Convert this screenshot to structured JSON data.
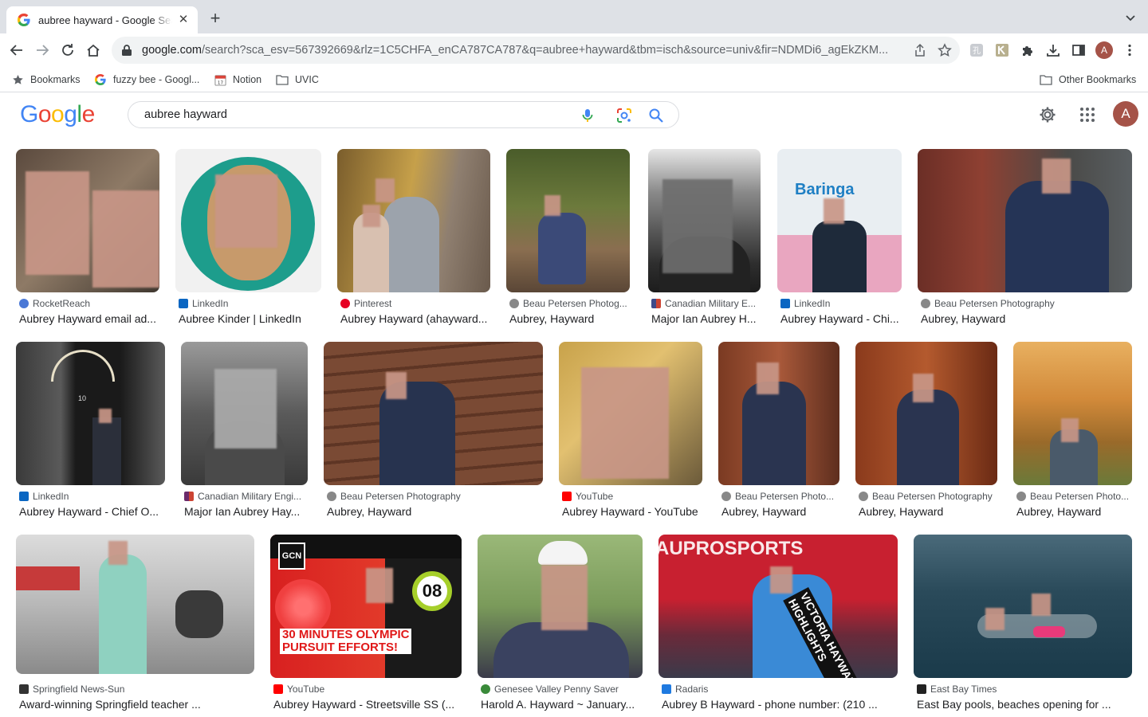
{
  "browser": {
    "tab_title": "aubree hayward - Google Search",
    "url_host": "google.com",
    "url_path": "/search?sca_esv=567392669&rlz=1C5CHFA_enCA787CA787&q=aubree+hayward&tbm=isch&source=univ&fir=NDMDi6_agEkZKM..."
  },
  "bookmarks": {
    "items": [
      "Bookmarks",
      "fuzzy bee - Googl...",
      "Notion",
      "UVIC"
    ],
    "other": "Other Bookmarks"
  },
  "google": {
    "logo": [
      "G",
      "o",
      "o",
      "g",
      "l",
      "e"
    ],
    "query": "aubree hayward",
    "avatar_letter": "A"
  },
  "profile_letter": "A",
  "results": [
    {
      "source": "RocketReach",
      "caption": "Aubrey Hayward email ad..."
    },
    {
      "source": "LinkedIn",
      "caption": "Aubree Kinder | LinkedIn"
    },
    {
      "source": "Pinterest",
      "caption": "Aubrey Hayward (ahayward..."
    },
    {
      "source": "Beau Petersen Photog...",
      "caption": "Aubrey, Hayward"
    },
    {
      "source": "Canadian Military E...",
      "caption": "Major Ian Aubrey H..."
    },
    {
      "source": "LinkedIn",
      "caption": "Aubrey Hayward - Chi..."
    },
    {
      "source": "Beau Petersen Photography",
      "caption": "Aubrey, Hayward"
    },
    {
      "source": "LinkedIn",
      "caption": "Aubrey Hayward - Chief O..."
    },
    {
      "source": "Canadian Military Engi...",
      "caption": "Major Ian Aubrey Hay..."
    },
    {
      "source": "Beau Petersen Photography",
      "caption": "Aubrey, Hayward"
    },
    {
      "source": "YouTube",
      "caption": "Aubrey Hayward - YouTube"
    },
    {
      "source": "Beau Petersen Photo...",
      "caption": "Aubrey, Hayward"
    },
    {
      "source": "Beau Petersen Photography",
      "caption": "Aubrey, Hayward"
    },
    {
      "source": "Beau Petersen Photo...",
      "caption": "Aubrey, Hayward"
    },
    {
      "source": "Springfield News-Sun",
      "caption": "Award-winning Springfield teacher ..."
    },
    {
      "source": "YouTube",
      "caption": "Aubrey Hayward - Streetsville SS (..."
    },
    {
      "source": "Genesee Valley Penny Saver",
      "caption": "Harold A. Hayward ~ January..."
    },
    {
      "source": "Radaris",
      "caption": "Aubrey B Hayward - phone number: (210 ..."
    },
    {
      "source": "East Bay Times",
      "caption": "East Bay pools, beaches opening for ..."
    }
  ],
  "thumb_text": {
    "baringa": "Baringa",
    "gcn": "GCN",
    "olympic_line1": "30 MINUTES OLYMPIC",
    "olympic_line2": "PURSUIT EFFORTS!",
    "badge": "08",
    "auprosports": "AUPROSPORTS",
    "victoria": "VICTORIA HAYWARD HIGHLIGHTS",
    "door_number": "10"
  },
  "colors": {
    "google_blue": "#4285f4",
    "google_red": "#ea4335",
    "google_yellow": "#fbbc05",
    "google_green": "#34a853"
  }
}
